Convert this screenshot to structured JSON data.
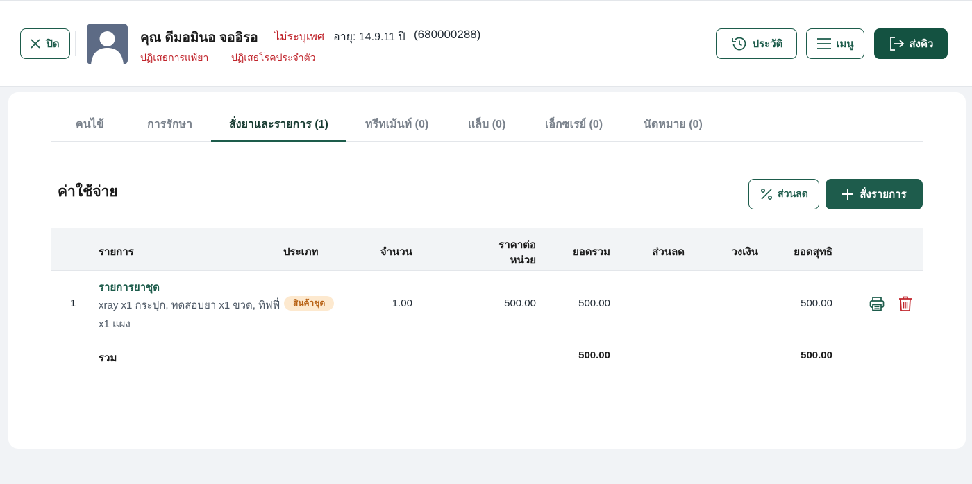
{
  "header": {
    "close_label": "ปิด",
    "patient_name": "คุณ ดีมอมินอ จออิรอ",
    "gender": "ไม่ระบุเพศ",
    "age": "อายุ: 14.9.11 ปี",
    "hn": "(680000288)",
    "allergy": "ปฏิเสธการแพ้ยา",
    "disease": "ปฏิเสธโรคประจำตัว",
    "history_label": "ประวัติ",
    "menu_label": "เมนู",
    "queue_label": "ส่งคิว"
  },
  "tabs": [
    {
      "label": "คนไข้",
      "active": false
    },
    {
      "label": "การรักษา",
      "active": false
    },
    {
      "label": "สั่งยาและรายการ (1)",
      "active": true
    },
    {
      "label": "ทรีทเม้นท์ (0)",
      "active": false
    },
    {
      "label": "แล็บ (0)",
      "active": false
    },
    {
      "label": "เอ็กซเรย์ (0)",
      "active": false
    },
    {
      "label": "นัดหมาย (0)",
      "active": false
    }
  ],
  "section": {
    "title": "ค่าใช้จ่าย",
    "discount_label": "ส่วนลด",
    "order_label": "สั่งรายการ"
  },
  "table": {
    "columns": {
      "item": "รายการ",
      "type": "ประเภท",
      "qty": "จำนวน",
      "unit_price_1": "ราคาต่อ",
      "unit_price_2": "หน่วย",
      "total": "ยอดรวม",
      "discount": "ส่วนลด",
      "credit": "วงเงิน",
      "net": "ยอดสุทธิ"
    },
    "rows": [
      {
        "no": "1",
        "name": "รายการยาชุด",
        "desc": "xray x1 กระปุก, ทดสอบยา x1 ขวด, ทิฟฟี่ x1 แผง",
        "type": "สินค้าชุด",
        "qty": "1.00",
        "unit_price": "500.00",
        "total": "500.00",
        "discount": "",
        "credit": "",
        "net": "500.00"
      }
    ],
    "summary": {
      "label": "รวม",
      "total": "500.00",
      "net": "500.00"
    }
  },
  "colors": {
    "primary": "#1e5c4c",
    "danger": "#c0242b",
    "badge_bg": "#fde9cf",
    "badge_text": "#b76114"
  },
  "icons": [
    "close-icon",
    "avatar-icon",
    "history-icon",
    "menu-icon",
    "send-icon",
    "percent-icon",
    "plus-icon",
    "print-icon",
    "trash-icon"
  ]
}
